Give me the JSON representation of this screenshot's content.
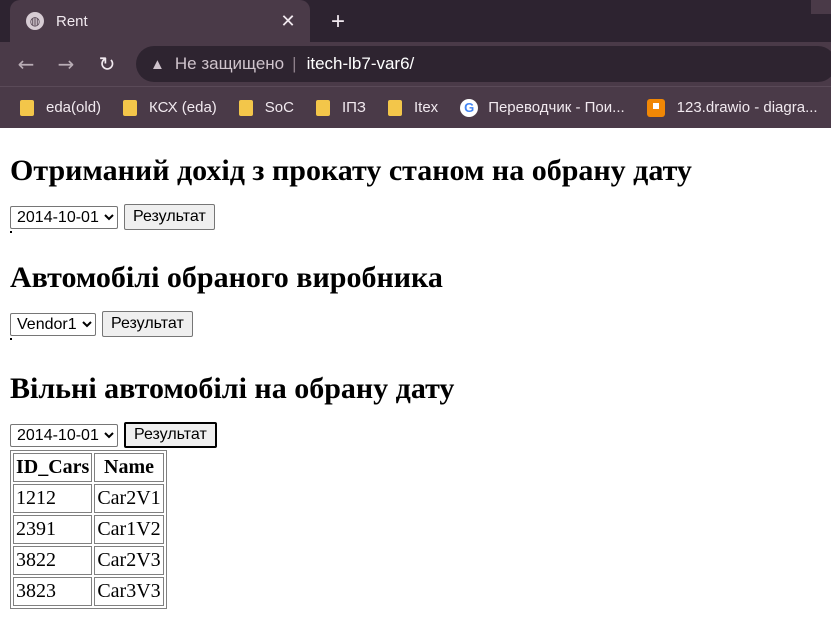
{
  "browser": {
    "tab_title": "Rent",
    "new_tab_symbol": "+",
    "close_symbol": "✕",
    "nav": {
      "back": "←",
      "forward": "→",
      "reload": "↻"
    },
    "address": {
      "security_label": "Не защищено",
      "separator": "|",
      "url": "itech-lb7-var6/"
    },
    "bookmarks": [
      {
        "label": "eda(old)",
        "icon": "folder-icon"
      },
      {
        "label": "КСХ (eda)",
        "icon": "folder-icon"
      },
      {
        "label": "SoC",
        "icon": "folder-icon"
      },
      {
        "label": "ІПЗ",
        "icon": "folder-icon"
      },
      {
        "label": "Itex",
        "icon": "folder-icon"
      },
      {
        "label": "Переводчик - Пои...",
        "icon": "google-translate-icon"
      },
      {
        "label": "123.drawio - diagra...",
        "icon": "drawio-icon"
      }
    ]
  },
  "page": {
    "income": {
      "heading": "Отриманий дохід з прокату станом на обрану дату",
      "date_selected": "2014-10-01",
      "submit_label": "Результат"
    },
    "vendor": {
      "heading": "Автомобілі обраного виробника",
      "vendor_selected": "Vendor1",
      "submit_label": "Результат"
    },
    "free_cars": {
      "heading": "Вільні автомобілі на обрану дату",
      "date_selected": "2014-10-01",
      "submit_label": "Результат",
      "table": {
        "columns": [
          "ID_Cars",
          "Name"
        ],
        "rows": [
          [
            "1212",
            "Car2V1"
          ],
          [
            "2391",
            "Car1V2"
          ],
          [
            "3822",
            "Car2V3"
          ],
          [
            "3823",
            "Car3V3"
          ]
        ]
      }
    }
  }
}
